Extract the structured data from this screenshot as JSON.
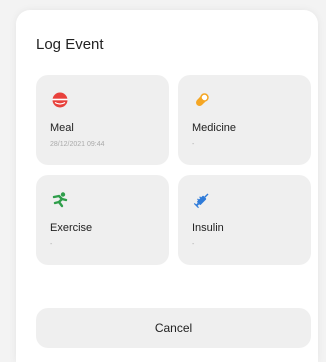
{
  "dialog": {
    "title": "Log Event",
    "cancel_label": "Cancel"
  },
  "events": [
    {
      "name": "meal",
      "label": "Meal",
      "subtitle": "28/12/2021 09:44",
      "icon": "meal-icon",
      "color": "#e8413c"
    },
    {
      "name": "medicine",
      "label": "Medicine",
      "subtitle": "-",
      "icon": "pill-icon",
      "color": "#f5a623"
    },
    {
      "name": "exercise",
      "label": "Exercise",
      "subtitle": "-",
      "icon": "exercise-icon",
      "color": "#2e9e4a"
    },
    {
      "name": "insulin",
      "label": "Insulin",
      "subtitle": "-",
      "icon": "syringe-icon",
      "color": "#2f7bd9"
    }
  ]
}
